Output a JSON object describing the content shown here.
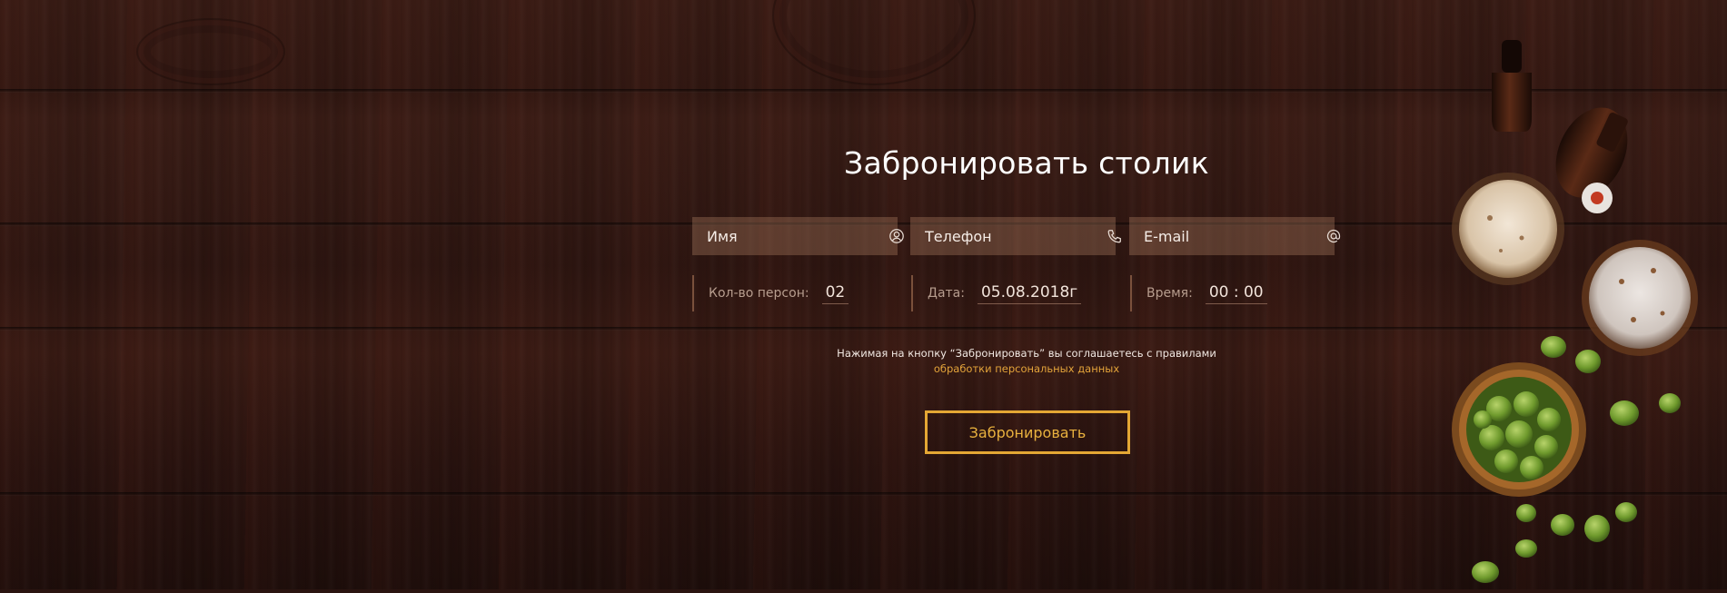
{
  "form": {
    "title": "Забронировать столик",
    "fields": {
      "name_placeholder": "Имя",
      "phone_placeholder": "Телефон",
      "email_placeholder": "E-mail"
    },
    "persons": {
      "label": "Кол-во персон:",
      "value": "02"
    },
    "date": {
      "label": "Дата:",
      "value": "05.08.2018г"
    },
    "time": {
      "label": "Время:",
      "value": "00 : 00"
    },
    "consent_text": "Нажимая на кнопку “Забронировать” вы соглашаетесь с правилами",
    "consent_link": "обработки персональных данных",
    "submit_label": "Забронировать"
  },
  "icons": {
    "name": "user-icon",
    "phone": "phone-icon",
    "email": "at-icon"
  },
  "colors": {
    "accent": "#e4a734",
    "link": "#e3a33a",
    "field_bg": "rgba(190,140,110,0.32)",
    "title": "#ffffff"
  }
}
